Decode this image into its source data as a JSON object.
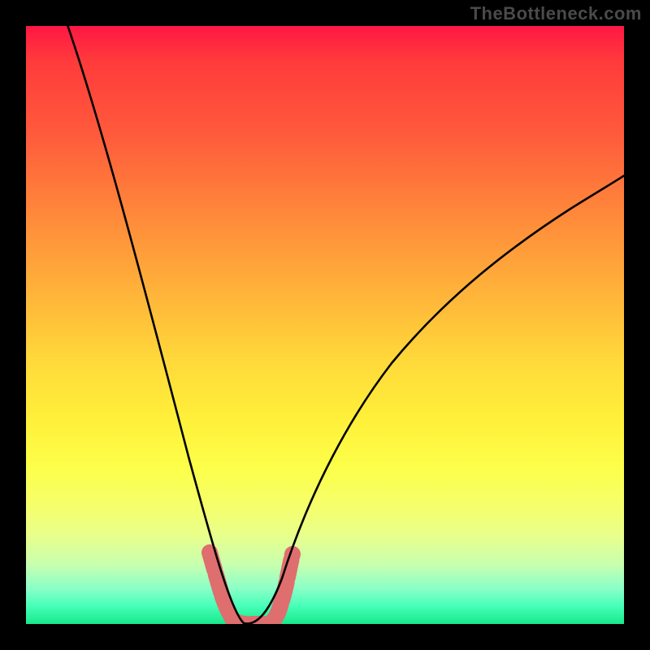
{
  "watermark": "TheBottleneck.com",
  "chart_data": {
    "type": "line",
    "title": "",
    "xlabel": "",
    "ylabel": "",
    "xlim": [
      0,
      100
    ],
    "ylim": [
      0,
      100
    ],
    "series": [
      {
        "name": "curve",
        "x": [
          0,
          5,
          10,
          15,
          20,
          25,
          28,
          30,
          32,
          33,
          34,
          36,
          38,
          40,
          42,
          45,
          50,
          55,
          60,
          65,
          70,
          75,
          80,
          85,
          90,
          95,
          100
        ],
        "y": [
          100,
          88,
          76,
          63,
          49,
          35,
          25,
          18,
          10,
          5,
          1,
          0,
          0,
          1,
          5,
          12,
          22,
          30,
          36,
          42,
          46,
          50,
          54,
          57,
          60,
          63,
          66
        ]
      }
    ],
    "annotations": {
      "trough_marker": {
        "x_range": [
          30.5,
          42.5
        ],
        "y_range": [
          0,
          10
        ],
        "color": "#e06f6f"
      }
    },
    "gradient_background": {
      "top": "#ff1744",
      "mid": "#ffe83a",
      "bottom": "#18e88c"
    }
  }
}
